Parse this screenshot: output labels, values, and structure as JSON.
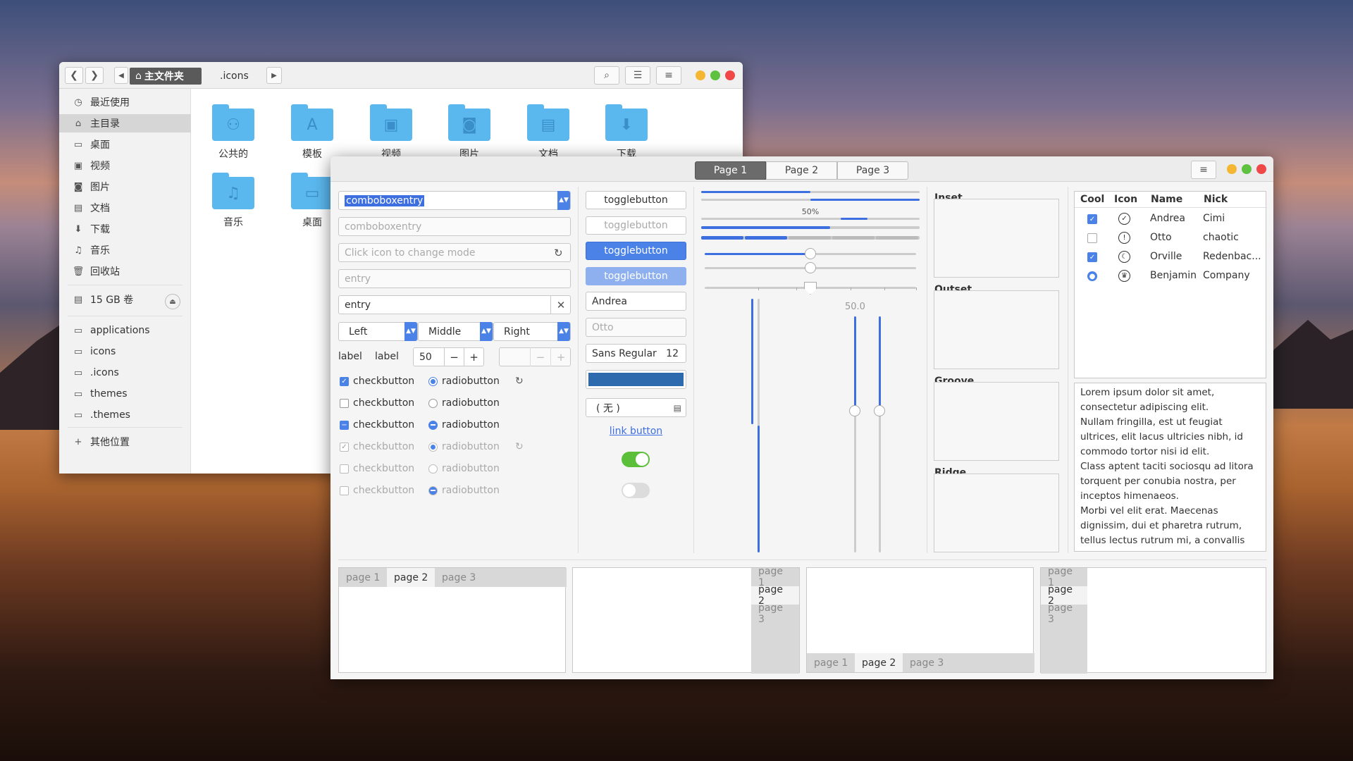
{
  "fm": {
    "nav_back": "❮",
    "nav_fwd": "❯",
    "crumb_home": "主文件夹",
    "crumb_icons": ".icons",
    "sidebar": [
      {
        "icon": "◷",
        "label": "最近使用"
      },
      {
        "icon": "⌂",
        "label": "主目录"
      },
      {
        "icon": "▭",
        "label": "桌面"
      },
      {
        "icon": "▣",
        "label": "视频"
      },
      {
        "icon": "◙",
        "label": "图片"
      },
      {
        "icon": "▤",
        "label": "文档"
      },
      {
        "icon": "⬇",
        "label": "下载"
      },
      {
        "icon": "♫",
        "label": "音乐"
      },
      {
        "icon": "🗑",
        "label": "回收站"
      }
    ],
    "volume": "15 GB 卷",
    "bookmarks": [
      "applications",
      "icons",
      ".icons",
      "themes",
      ".themes"
    ],
    "other": "其他位置",
    "folders": [
      {
        "label": "公共的",
        "glyph": "⚇"
      },
      {
        "label": "模板",
        "glyph": "A"
      },
      {
        "label": "视频",
        "glyph": "▣"
      },
      {
        "label": "图片",
        "glyph": "◙"
      },
      {
        "label": "文档",
        "glyph": "▤"
      },
      {
        "label": "下载",
        "glyph": "⬇"
      },
      {
        "label": "音乐",
        "glyph": "♫"
      },
      {
        "label": "桌面",
        "glyph": "▭"
      }
    ]
  },
  "wf": {
    "tabs": [
      "Page 1",
      "Page 2",
      "Page 3"
    ],
    "combo1": "comboboxentry",
    "combo2": "comboboxentry",
    "entry_icon_ph": "Click icon to change mode",
    "entry_ph": "entry",
    "entry_val": "entry",
    "combos3": [
      "Left",
      "Middle",
      "Right"
    ],
    "label1": "label",
    "label2": "label",
    "spin_val": "50",
    "checks": [
      "checkbutton",
      "checkbutton",
      "checkbutton",
      "checkbutton",
      "checkbutton",
      "checkbutton"
    ],
    "radios": [
      "radiobutton",
      "radiobutton",
      "radiobutton",
      "radiobutton",
      "radiobutton",
      "radiobutton"
    ],
    "toggles": [
      "togglebutton",
      "togglebutton",
      "togglebutton",
      "togglebutton"
    ],
    "combo_andrea": "Andrea",
    "combo_otto": "Otto",
    "font_name": "Sans Regular",
    "font_size": "12",
    "file_none": "( 无 )",
    "link": "link button",
    "progress": {
      "label": "50%",
      "value": 0.5
    },
    "scale_val": "50.0",
    "frames": [
      "Inset",
      "Outset",
      "Groove",
      "Ridge"
    ],
    "tree": {
      "headers": [
        "Cool",
        "Icon",
        "Name",
        "Nick"
      ],
      "rows": [
        {
          "name": "Andrea",
          "nick": "Cimi"
        },
        {
          "name": "Otto",
          "nick": "chaotic"
        },
        {
          "name": "Orville",
          "nick": "Redenbac..."
        },
        {
          "name": "Benjamin",
          "nick": "Company"
        }
      ]
    },
    "lorem": [
      "Lorem ipsum dolor sit amet,",
      "consectetur adipiscing elit.",
      "Nullam fringilla, est ut feugiat",
      "ultrices, elit lacus ultricies nibh, id",
      "commodo tortor nisi id elit.",
      "Class aptent taciti sociosqu ad litora",
      "torquent per conubia nostra, per",
      "inceptos himenaeos.",
      "Morbi vel elit erat. Maecenas",
      "dignissim, dui et pharetra rutrum,",
      "tellus lectus rutrum mi, a convallis"
    ],
    "nbtabs": [
      "page 1",
      "page 2",
      "page 3"
    ]
  }
}
